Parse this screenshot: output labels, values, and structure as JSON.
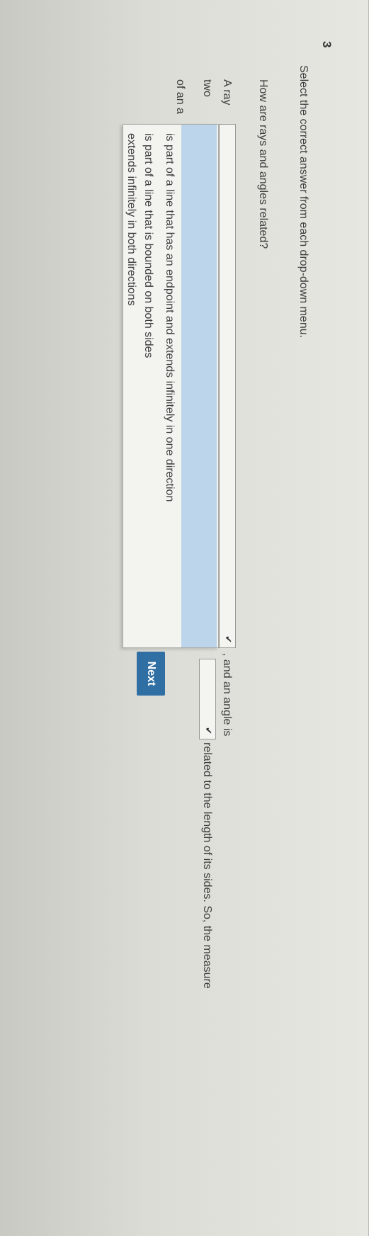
{
  "question": {
    "number": "3",
    "instruction": "Select the correct answer from each drop-down menu.",
    "prompt": "How are rays and angles related?",
    "sentence": {
      "part1": "A ray",
      "part2": ", and an angle is",
      "part3": "two",
      "part4": "related to the length of its sides. So, the measure",
      "part5": "of an a"
    }
  },
  "select1": {
    "value": "",
    "open": true,
    "options": [
      "",
      "is part of a line that has an endpoint and extends infinitely in one direction",
      "is part of a line that is bounded on both sides",
      "extends infinitely in both directions"
    ]
  },
  "select2": {
    "value": ""
  },
  "next_button": {
    "label": "Next"
  },
  "colors": {
    "highlight": "#bcd5ea",
    "button": "#2f6fa3"
  }
}
